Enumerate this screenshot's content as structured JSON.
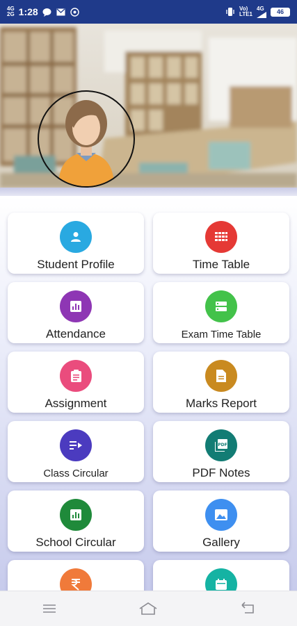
{
  "status_bar": {
    "network_left_top": "4G",
    "network_left_bottom": "2G",
    "time": "1:28",
    "volte_top": "Vo)",
    "volte_bottom": "LTE1",
    "network_right": "4G",
    "battery": "46"
  },
  "menu": [
    {
      "label": "Student Profile",
      "icon": "person-icon",
      "color": "#29a9e1"
    },
    {
      "label": "Time Table",
      "icon": "grid-icon",
      "color": "#e53935"
    },
    {
      "label": "Attendance",
      "icon": "chart-icon",
      "color": "#8e36b4"
    },
    {
      "label": "Exam Time Table",
      "icon": "list-icon",
      "color": "#43c24a"
    },
    {
      "label": "Assignment",
      "icon": "clipboard-icon",
      "color": "#ea4c7d"
    },
    {
      "label": "Marks Report",
      "icon": "document-icon",
      "color": "#c98a20"
    },
    {
      "label": "Class Circular",
      "icon": "circular-icon",
      "color": "#4b3bbf"
    },
    {
      "label": "PDF Notes",
      "icon": "pdf-icon",
      "color": "#127c74"
    },
    {
      "label": "School Circular",
      "icon": "chart-icon",
      "color": "#1f8a3a"
    },
    {
      "label": "Gallery",
      "icon": "image-icon",
      "color": "#3e8ff0"
    },
    {
      "label": "",
      "icon": "rupee-icon",
      "color": "#f07a3a"
    },
    {
      "label": "",
      "icon": "calendar-icon",
      "color": "#15b3a3"
    }
  ]
}
